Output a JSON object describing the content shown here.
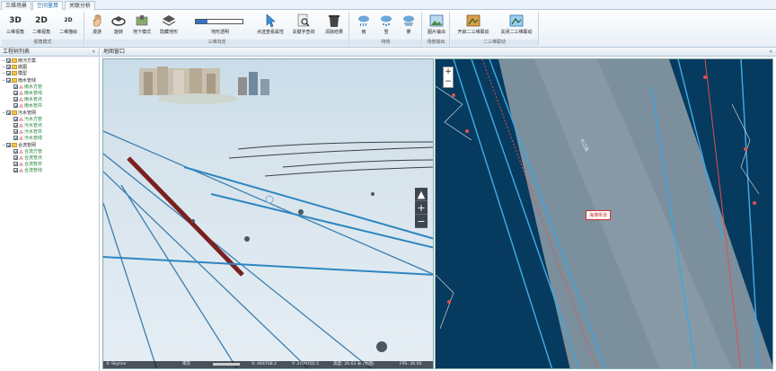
{
  "tabs": [
    {
      "label": "三维场景",
      "active": false
    },
    {
      "label": "空间量算",
      "active": true
    },
    {
      "label": "关联分析",
      "active": false
    }
  ],
  "ribbon": {
    "groups": [
      {
        "label": "视角模式",
        "buttons": [
          {
            "label": "三维视角",
            "icon": "3d-text-icon",
            "text": "3D"
          },
          {
            "label": "二维视角",
            "icon": "2d-text-icon",
            "text": "2D"
          },
          {
            "label": "二维描绘",
            "icon": "2d-draw-icon",
            "text": "2D"
          }
        ]
      },
      {
        "label": "三维浏览",
        "buttons": [
          {
            "label": "漫游",
            "icon": "hand-icon"
          },
          {
            "label": "旋转",
            "icon": "rotate-icon"
          },
          {
            "label": "地下模式",
            "icon": "underground-icon"
          },
          {
            "label": "隐藏地形",
            "icon": "layers-icon"
          },
          {
            "label": "点选查看属性",
            "icon": "cursor-icon"
          },
          {
            "label": "关键字查询",
            "icon": "search-doc-icon"
          },
          {
            "label": "清除结果",
            "icon": "trash-icon"
          }
        ],
        "slider_label": "地形透明",
        "slider_value": 0.25
      },
      {
        "label": "特效",
        "buttons": [
          {
            "label": "雨",
            "icon": "rain-icon"
          },
          {
            "label": "雪",
            "icon": "snow-icon"
          },
          {
            "label": "雾",
            "icon": "fog-icon"
          }
        ]
      },
      {
        "label": "场景输出",
        "buttons": [
          {
            "label": "图片输出",
            "icon": "image-export-icon"
          }
        ]
      },
      {
        "label": "二三维联动",
        "buttons": [
          {
            "label": "开启二三维联动",
            "icon": "link-on-icon"
          },
          {
            "label": "关闭二三维联动",
            "icon": "link-off-icon"
          }
        ]
      }
    ]
  },
  "left_panel": {
    "title": "工程树列表",
    "collapse": "«",
    "tree": [
      {
        "label": "雨污方案",
        "type": "folder",
        "level": 0
      },
      {
        "label": "底图",
        "type": "folder",
        "level": 0
      },
      {
        "label": "模型",
        "type": "folder",
        "level": 0
      },
      {
        "label": "雨水管线",
        "type": "folder",
        "level": 0
      },
      {
        "label": "雨水方管",
        "type": "layer",
        "level": 1
      },
      {
        "label": "雨水管线",
        "type": "layer",
        "level": 1
      },
      {
        "label": "雨水管点",
        "type": "layer",
        "level": 1
      },
      {
        "label": "雨水管井",
        "type": "layer",
        "level": 1
      },
      {
        "label": "污水管网",
        "type": "folder",
        "level": 0
      },
      {
        "label": "污水方管",
        "type": "layer",
        "level": 1
      },
      {
        "label": "污水管点",
        "type": "layer",
        "level": 1
      },
      {
        "label": "污水管井",
        "type": "layer",
        "level": 1
      },
      {
        "label": "污水管线",
        "type": "layer",
        "level": 1
      },
      {
        "label": "合流管网",
        "type": "folder",
        "level": 0
      },
      {
        "label": "合流方管",
        "type": "layer",
        "level": 1
      },
      {
        "label": "合流管点",
        "type": "layer",
        "level": 1
      },
      {
        "label": "合流管井",
        "type": "layer",
        "level": 1
      },
      {
        "label": "合流管线",
        "type": "layer",
        "level": 1
      }
    ]
  },
  "map": {
    "title": "地图窗口",
    "collapse": "«",
    "status3d": {
      "brand": "© Skyline",
      "layer": "南京",
      "x": "X: 464768.2",
      "y": "Y: 3709765.5",
      "alt": "高度: 26.63 米 (地面)",
      "fps": "FPS: 30.00"
    },
    "map2d_label": "海港街道",
    "road_label": "长江路",
    "colors": {
      "water": "#073a5f",
      "road": "#7c8f9d",
      "pipe": "#3ea7de",
      "rain": "#e05050"
    }
  }
}
